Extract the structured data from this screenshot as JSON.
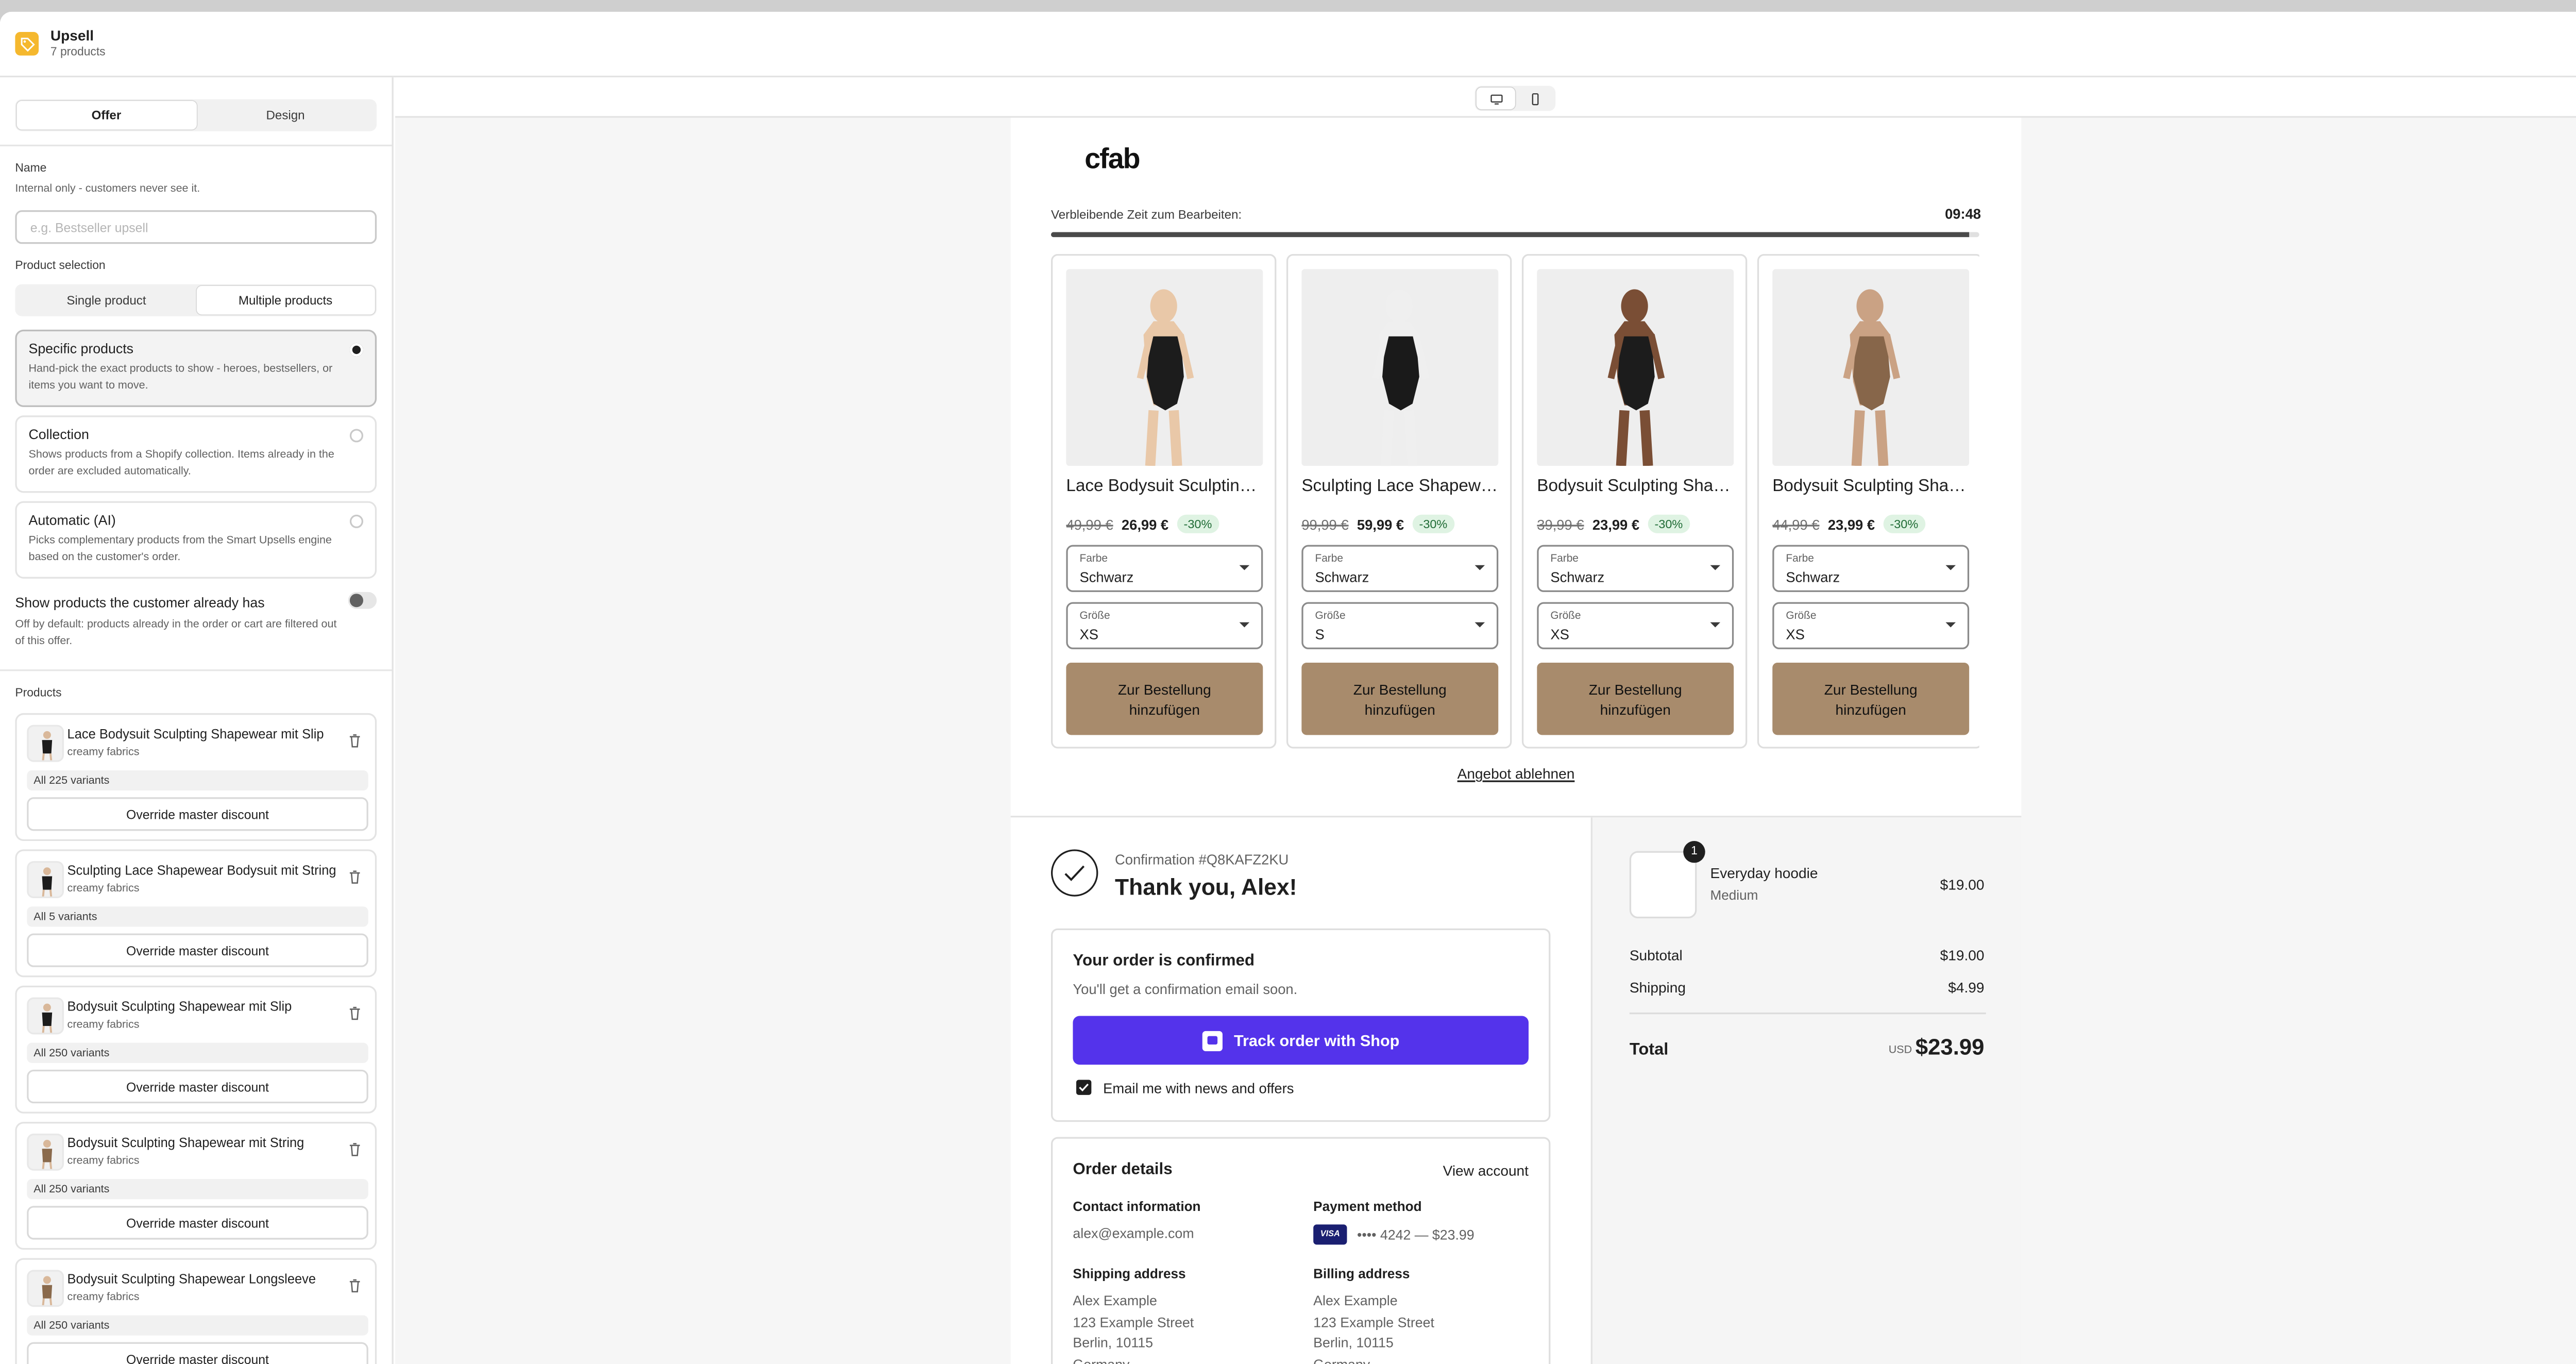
{
  "header": {
    "title": "Upsell",
    "subtitle": "7 products"
  },
  "sidebar": {
    "tabs": [
      {
        "label": "Offer",
        "active": true
      },
      {
        "label": "Design",
        "active": false
      }
    ],
    "name_label": "Name",
    "name_hint": "Internal only - customers never see it.",
    "name_placeholder": "e.g. Bestseller upsell",
    "product_selection_label": "Product selection",
    "selection_modes": [
      {
        "label": "Single product",
        "active": false
      },
      {
        "label": "Multiple products",
        "active": true
      }
    ],
    "options": [
      {
        "title": "Specific products",
        "desc": "Hand-pick the exact products to show - heroes, bestsellers, or items you want to move.",
        "selected": true
      },
      {
        "title": "Collection",
        "desc": "Shows products from a Shopify collection. Items already in the order are excluded automatically.",
        "selected": false
      },
      {
        "title": "Automatic (AI)",
        "desc": "Picks complementary products from the Smart Upsells engine based on the customer's order.",
        "selected": false
      }
    ],
    "show_owned_label": "Show products the customer already has",
    "show_owned_hint": "Off by default: products already in the order or cart are filtered out of this offer.",
    "products_label": "Products",
    "products": [
      {
        "name": "Lace Bodysuit Sculpting Shapewear mit Slip",
        "vendor": "creamy fabrics",
        "variants": "All 225 variants",
        "override": "Override master discount",
        "tone": "#1c1c1c"
      },
      {
        "name": "Sculpting Lace Shapewear Bodysuit mit String",
        "vendor": "creamy fabrics",
        "variants": "All 5 variants",
        "override": "Override master discount",
        "tone": "#1c1c1c"
      },
      {
        "name": "Bodysuit Sculpting Shapewear mit Slip",
        "vendor": "creamy fabrics",
        "variants": "All 250 variants",
        "override": "Override master discount",
        "tone": "#1c1c1c"
      },
      {
        "name": "Bodysuit Sculpting Shapewear mit String",
        "vendor": "creamy fabrics",
        "variants": "All 250 variants",
        "override": "Override master discount",
        "tone": "#8a6a4c"
      },
      {
        "name": "Bodysuit Sculpting Shapewear Longsleeve",
        "vendor": "creamy fabrics",
        "variants": "All 250 variants",
        "override": "Override master discount",
        "tone": "#8a6a4c"
      }
    ]
  },
  "preview": {
    "logo": "cfab",
    "timer_label": "Verbleibende Zeit zum Bearbeiten:",
    "timer_value": "09:48",
    "timer_progress": 0.99,
    "products": [
      {
        "name": "Lace Bodysuit Sculpting Shapewear",
        "old": "49,99 €",
        "new": "26,99 €",
        "discount": "-30%",
        "color_label": "Farbe",
        "color": "Schwarz",
        "size_label": "Größe",
        "size": "XS",
        "button": "Zur Bestellung hinzufügen",
        "tone": "#1c1c1c",
        "skin": "#e9c8a8"
      },
      {
        "name": "Sculpting Lace Shapewear Bodysuit",
        "old": "99,99 €",
        "new": "59,99 €",
        "discount": "-30%",
        "color_label": "Farbe",
        "color": "Schwarz",
        "size_label": "Größe",
        "size": "S",
        "button": "Zur Bestellung hinzufügen",
        "tone": "#1a1a1a",
        "skin": "#efefef"
      },
      {
        "name": "Bodysuit Sculpting Shapewear mit Slip",
        "old": "39,99 €",
        "new": "23,99 €",
        "discount": "-30%",
        "color_label": "Farbe",
        "color": "Schwarz",
        "size_label": "Größe",
        "size": "XS",
        "button": "Zur Bestellung hinzufügen",
        "tone": "#1c1c1c",
        "skin": "#7a4e35"
      },
      {
        "name": "Bodysuit Sculpting Shapewear mit String",
        "old": "44,99 €",
        "new": "23,99 €",
        "discount": "-30%",
        "color_label": "Farbe",
        "color": "Schwarz",
        "size_label": "Größe",
        "size": "XS",
        "button": "Zur Bestellung hinzufügen",
        "tone": "#87664a",
        "skin": "#caa284"
      }
    ],
    "decline": "Angebot ablehnen",
    "confirmation": "Confirmation #Q8KAFZ2KU",
    "thanks": "Thank you, Alex!",
    "confirmed_title": "Your order is confirmed",
    "confirmed_desc": "You'll get a confirmation email soon.",
    "track_button": "Track order with Shop",
    "email_opt": "Email me with news and offers",
    "order_details": "Order details",
    "view_account": "View account",
    "contact_label": "Contact information",
    "contact_value": "alex@example.com",
    "payment_label": "Payment method",
    "payment_value": "•••• 4242 — $23.99",
    "visa": "VISA",
    "shipping_label": "Shipping address",
    "billing_label": "Billing address",
    "address_lines": [
      "Alex Example",
      "123 Example Street",
      "Berlin, 10115",
      "Germany"
    ],
    "summary": {
      "item_name": "Everyday hoodie",
      "item_variant": "Medium",
      "item_price": "$19.00",
      "qty": "1",
      "subtotal_label": "Subtotal",
      "subtotal": "$19.00",
      "shipping_label": "Shipping",
      "shipping": "$4.99",
      "total_label": "Total",
      "currency": "USD",
      "total": "$23.99"
    }
  }
}
